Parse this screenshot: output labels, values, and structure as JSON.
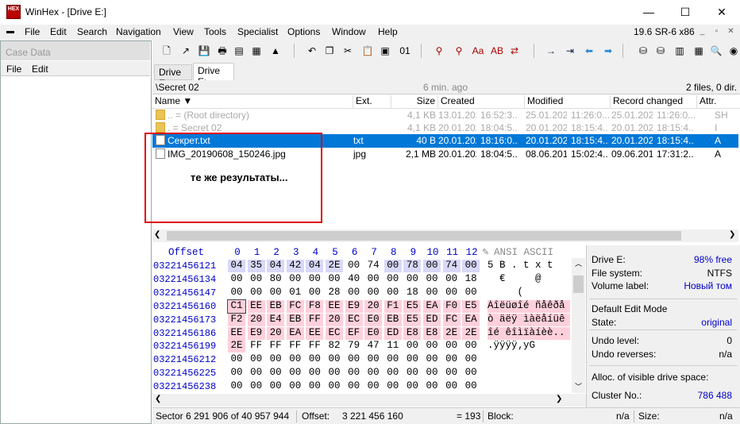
{
  "window": {
    "title": "WinHex - [Drive E:]",
    "app_icon_text": "HEX",
    "minimize": "—",
    "maximize": "☐",
    "close": "✕"
  },
  "menu": [
    "File",
    "Edit",
    "Search",
    "Navigation",
    "View",
    "Tools",
    "Specialist",
    "Options",
    "Window",
    "Help"
  ],
  "version": "19.6 SR-6 x86",
  "case": {
    "header": "Case Data",
    "menu": [
      "File",
      "Edit"
    ]
  },
  "tabs": [
    "Drive E:",
    "Drive E:"
  ],
  "path": {
    "folder": "\\Secret 02",
    "time": "6 min. ago",
    "summary": "2 files, 0 dir."
  },
  "columns": [
    "Name",
    "Ext.",
    "Size",
    "Created",
    "Modified",
    "Record changed",
    "Attr."
  ],
  "files": [
    {
      "name": "..  =  (Root directory)",
      "ext": "",
      "size": "4,1 KB",
      "created": "13.01.2020",
      "ctime": "16:52:3...",
      "modified": "25.01.2020",
      "mtime": "11:26:0...",
      "record": "25.01.2020",
      "rtime": "11:26:0...",
      "attr": "SH"
    },
    {
      "name": ".  =  Secret 02",
      "ext": "",
      "size": "4,1 KB",
      "created": "20.01.2020",
      "ctime": "18:04:5...",
      "modified": "20.01.2020",
      "mtime": "18:15:4...",
      "record": "20.01.2020",
      "rtime": "18:15:4...",
      "attr": "I"
    },
    {
      "name": "Секрет.txt",
      "ext": "txt",
      "size": "40 B",
      "created": "20.01.2020",
      "ctime": "18:16:0...",
      "modified": "20.01.2020",
      "mtime": "18:15:4...",
      "record": "20.01.2020",
      "rtime": "18:15:4...",
      "attr": "A"
    },
    {
      "name": "IMG_20190608_150246.jpg",
      "ext": "jpg",
      "size": "2,1 MB",
      "created": "20.01.2020",
      "ctime": "18:04:5...",
      "modified": "08.06.2019",
      "mtime": "15:02:4...",
      "record": "09.06.2019",
      "rtime": "17:31:2...",
      "attr": "A"
    }
  ],
  "annotation": "те же результаты...",
  "hex": {
    "offset_label": "Offset",
    "cols": [
      "0",
      "1",
      "2",
      "3",
      "4",
      "5",
      "6",
      "7",
      "8",
      "9",
      "10",
      "11",
      "12"
    ],
    "ascii_label": "ANSI ASCII",
    "rows": [
      {
        "off": "03221456121",
        "b": [
          "04",
          "35",
          "04",
          "42",
          "04",
          "2E",
          "00",
          "74",
          "00",
          "78",
          "00",
          "74",
          "00"
        ],
        "a": "5 B . t x t"
      },
      {
        "off": "03221456134",
        "b": [
          "00",
          "00",
          "80",
          "00",
          "00",
          "00",
          "40",
          "00",
          "00",
          "00",
          "00",
          "00",
          "18"
        ],
        "a": "  €     @"
      },
      {
        "off": "03221456147",
        "b": [
          "00",
          "00",
          "00",
          "01",
          "00",
          "28",
          "00",
          "00",
          "00",
          "18",
          "00",
          "00",
          "00"
        ],
        "a": "     ("
      },
      {
        "off": "03221456160",
        "b": [
          "C1",
          "EE",
          "EB",
          "FC",
          "F8",
          "EE",
          "E9",
          "20",
          "F1",
          "E5",
          "EA",
          "F0",
          "E5"
        ],
        "a": "Áîëüøîé ñåêðå"
      },
      {
        "off": "03221456173",
        "b": [
          "F2",
          "20",
          "E4",
          "EB",
          "FF",
          "20",
          "EC",
          "E0",
          "EB",
          "E5",
          "ED",
          "FC",
          "EA"
        ],
        "a": "ò äëÿ ìàëåíüê"
      },
      {
        "off": "03221456186",
        "b": [
          "EE",
          "E9",
          "20",
          "EA",
          "EE",
          "EC",
          "EF",
          "E0",
          "ED",
          "E8",
          "E8",
          "2E",
          "2E"
        ],
        "a": "îé êîìïàíèè.."
      },
      {
        "off": "03221456199",
        "b": [
          "2E",
          "FF",
          "FF",
          "FF",
          "FF",
          "82",
          "79",
          "47",
          "11",
          "00",
          "00",
          "00",
          "00"
        ],
        "a": ".ÿÿÿÿ‚yG"
      },
      {
        "off": "03221456212",
        "b": [
          "00",
          "00",
          "00",
          "00",
          "00",
          "00",
          "00",
          "00",
          "00",
          "00",
          "00",
          "00",
          "00"
        ],
        "a": ""
      },
      {
        "off": "03221456225",
        "b": [
          "00",
          "00",
          "00",
          "00",
          "00",
          "00",
          "00",
          "00",
          "00",
          "00",
          "00",
          "00",
          "00"
        ],
        "a": ""
      },
      {
        "off": "03221456238",
        "b": [
          "00",
          "00",
          "00",
          "00",
          "00",
          "00",
          "00",
          "00",
          "00",
          "00",
          "00",
          "00",
          "00"
        ],
        "a": ""
      }
    ]
  },
  "info": [
    {
      "l": "Drive E:",
      "v": "98% free"
    },
    {
      "l": "File system:",
      "v": "NTFS"
    },
    {
      "l": "Volume label:",
      "v": "Новый том"
    },
    {
      "l": "Default Edit Mode",
      "v": ""
    },
    {
      "l": "State:",
      "v": "original"
    },
    {
      "l": "Undo level:",
      "v": "0"
    },
    {
      "l": "Undo reverses:",
      "v": "n/a"
    },
    {
      "l": "Alloc. of visible drive space:",
      "v": ""
    },
    {
      "l": "Cluster No.:",
      "v": "786 488"
    }
  ],
  "status": {
    "sector": "Sector 6 291 906 of 40 957 944",
    "offset_label": "Offset:",
    "offset": "3 221 456 160",
    "value": "= 193",
    "block_label": "Block:",
    "block": "n/a",
    "size_label": "Size:",
    "size": "n/a"
  },
  "colors": {
    "selection": "#0078d7",
    "hex_blue": "#0000c8",
    "hex_pink": "#ffd0dc",
    "hex_purple": "#d8d8f8",
    "red_box": "#dd0000"
  }
}
